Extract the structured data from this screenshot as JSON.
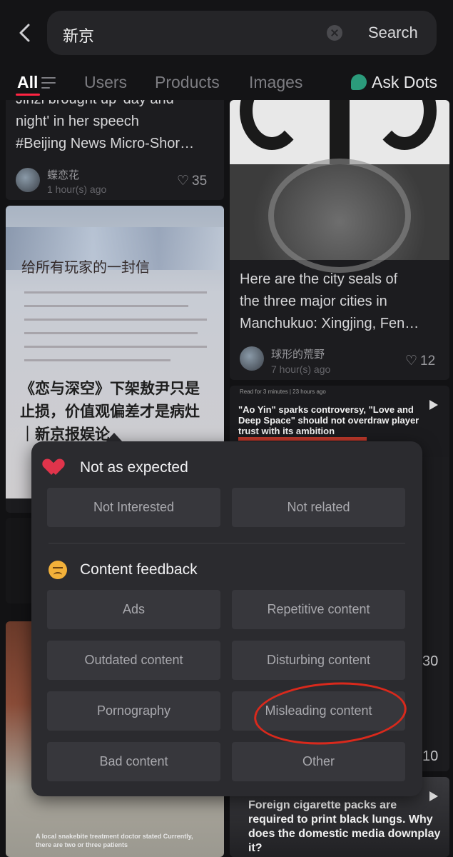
{
  "header": {
    "search_value": "新京",
    "search_button": "Search"
  },
  "tabs": [
    {
      "label": "All"
    },
    {
      "label": "Users"
    },
    {
      "label": "Products"
    },
    {
      "label": "Images"
    }
  ],
  "ask_dots": "Ask Dots",
  "feed": {
    "card1": {
      "title_lines": [
        "Jinzi brought up 'day and",
        "night' in her speech",
        "#Beijing News Micro-Shor…"
      ],
      "author": "蝶恋花",
      "time": "1 hour(s) ago",
      "likes": "35"
    },
    "card2": {
      "heading": "给所有玩家的一封信",
      "overlay": "《恋与深空》下架敖尹只是止损，价值观偏差才是病灶｜新京报娱论"
    },
    "card3": {
      "title_lines": [
        "Here are the city seals of",
        "the three major cities in",
        "Manchukuo: Xingjing, Fen…"
      ],
      "author": "球形的荒野",
      "time": "7 hour(s) ago",
      "likes": "12"
    },
    "card4": {
      "meta": "Read for 3 minutes | 23 hours ago",
      "headline": "\"Ao Yin\" sparks controversy, \"Love and Deep Space\" should not overdraw player trust with its ambition"
    },
    "snake_caption": "A local snakebite treatment doctor stated Currently, there are two or three patients",
    "cigarette_title": "Foreign cigarette packs are required to print black lungs. Why does the domestic media downplay it?",
    "side_fragments": [
      "30",
      "10"
    ]
  },
  "popup": {
    "section1_title": "Not as expected",
    "section1_icon": "broken-heart-icon",
    "section1_options": [
      "Not Interested",
      "Not related"
    ],
    "section2_title": "Content feedback",
    "section2_icon": "sad-face-icon",
    "section2_options": [
      "Ads",
      "Repetitive content",
      "Outdated content",
      "Disturbing content",
      "Pornography",
      "Misleading content",
      "Bad content",
      "Other"
    ]
  },
  "colors": {
    "accent": "#ff2442",
    "annotation": "#d9291c",
    "popup_bg": "#2b2b2f"
  }
}
